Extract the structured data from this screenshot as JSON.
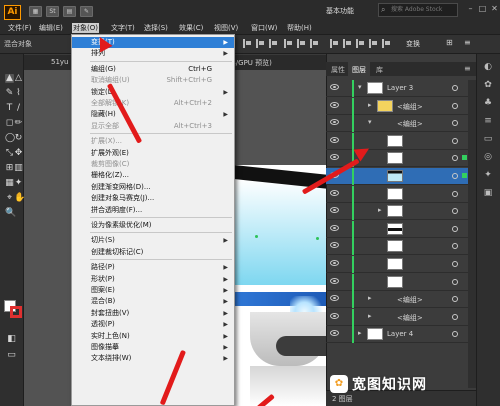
{
  "app": {
    "logo_text": "Ai",
    "workspace": "基本功能",
    "search_placeholder": "搜索 Adobe Stock",
    "control_label": "混合对象",
    "transform_label": "变换"
  },
  "menubar": [
    "文件(F)",
    "编辑(E)",
    "对象(O)",
    "文字(T)",
    "选择(S)",
    "效果(C)",
    "视图(V)",
    "窗口(W)",
    "帮助(H)"
  ],
  "toolbar_icons": {
    "st": "St"
  },
  "doc_tabs": {
    "left": "51yu",
    "right": "B/GPU 预览)"
  },
  "object_menu": [
    {
      "label": "变换(T)",
      "shortcut": "",
      "submenu": true,
      "disabled": false,
      "highlight": true
    },
    {
      "label": "排列",
      "shortcut": "",
      "submenu": true,
      "disabled": false
    },
    {
      "sep": true
    },
    {
      "label": "编组(G)",
      "shortcut": "Ctrl+G",
      "submenu": false,
      "disabled": false
    },
    {
      "label": "取消编组(U)",
      "shortcut": "Shift+Ctrl+G",
      "submenu": false,
      "disabled": true
    },
    {
      "label": "锁定(L)",
      "shortcut": "",
      "submenu": true,
      "disabled": false
    },
    {
      "label": "全部解锁(K)",
      "shortcut": "Alt+Ctrl+2",
      "submenu": false,
      "disabled": true
    },
    {
      "label": "隐藏(H)",
      "shortcut": "",
      "submenu": true,
      "disabled": false
    },
    {
      "label": "显示全部",
      "shortcut": "Alt+Ctrl+3",
      "submenu": false,
      "disabled": true
    },
    {
      "sep": true
    },
    {
      "label": "扩展(X)...",
      "shortcut": "",
      "submenu": false,
      "disabled": true
    },
    {
      "label": "扩展外观(E)",
      "shortcut": "",
      "submenu": false,
      "disabled": false
    },
    {
      "label": "裁剪图像(C)",
      "shortcut": "",
      "submenu": false,
      "disabled": true
    },
    {
      "label": "栅格化(Z)...",
      "shortcut": "",
      "submenu": false,
      "disabled": false
    },
    {
      "label": "创建渐变网格(D)...",
      "shortcut": "",
      "submenu": false,
      "disabled": false
    },
    {
      "label": "创建对象马赛克(J)...",
      "shortcut": "",
      "submenu": false,
      "disabled": false
    },
    {
      "label": "拼合透明度(F)...",
      "shortcut": "",
      "submenu": false,
      "disabled": false
    },
    {
      "sep": true
    },
    {
      "label": "设为像素级优化(M)",
      "shortcut": "",
      "submenu": false,
      "disabled": false
    },
    {
      "sep": true
    },
    {
      "label": "切片(S)",
      "shortcut": "",
      "submenu": true,
      "disabled": false
    },
    {
      "label": "创建裁切标记(C)",
      "shortcut": "",
      "submenu": false,
      "disabled": false
    },
    {
      "sep": true
    },
    {
      "label": "路径(P)",
      "shortcut": "",
      "submenu": true,
      "disabled": false
    },
    {
      "label": "形状(P)",
      "shortcut": "",
      "submenu": true,
      "disabled": false
    },
    {
      "label": "图案(E)",
      "shortcut": "",
      "submenu": true,
      "disabled": false
    },
    {
      "label": "混合(B)",
      "shortcut": "",
      "submenu": true,
      "disabled": false
    },
    {
      "label": "封套扭曲(V)",
      "shortcut": "",
      "submenu": true,
      "disabled": false
    },
    {
      "label": "透视(P)",
      "shortcut": "",
      "submenu": true,
      "disabled": false
    },
    {
      "label": "实时上色(N)",
      "shortcut": "",
      "submenu": true,
      "disabled": false
    },
    {
      "label": "图像描摹",
      "shortcut": "",
      "submenu": true,
      "disabled": false
    },
    {
      "label": "文本绕排(W)",
      "shortcut": "",
      "submenu": true,
      "disabled": false
    }
  ],
  "layers_panel": {
    "tabs": [
      "属性",
      "图层",
      "库"
    ],
    "active_tab": "图层",
    "layer_count": "2 图层",
    "rows": [
      {
        "indent": 0,
        "twirl": "▾",
        "name": "Layer 3",
        "thumb": "layer",
        "selected": false,
        "square": false
      },
      {
        "indent": 1,
        "twirl": "▸",
        "name": "<编组>",
        "thumb": "yellow",
        "selected": false,
        "square": false
      },
      {
        "indent": 1,
        "twirl": "▾",
        "name": "<编组>",
        "thumb": "blank",
        "selected": false,
        "square": false
      },
      {
        "indent": 2,
        "twirl": "",
        "name": "",
        "thumb": "white",
        "selected": false,
        "square": false
      },
      {
        "indent": 2,
        "twirl": "",
        "name": "",
        "thumb": "white",
        "selected": false,
        "square": true
      },
      {
        "indent": 2,
        "twirl": "",
        "name": "",
        "thumb": "screen",
        "selected": true,
        "square": true
      },
      {
        "indent": 2,
        "twirl": "",
        "name": "",
        "thumb": "white",
        "selected": false,
        "square": false
      },
      {
        "indent": 2,
        "twirl": "▸",
        "name": "",
        "thumb": "white",
        "selected": false,
        "square": false
      },
      {
        "indent": 2,
        "twirl": "",
        "name": "",
        "thumb": "dark",
        "selected": false,
        "square": false
      },
      {
        "indent": 2,
        "twirl": "",
        "name": "",
        "thumb": "white",
        "selected": false,
        "square": false
      },
      {
        "indent": 2,
        "twirl": "",
        "name": "",
        "thumb": "white",
        "selected": false,
        "square": false
      },
      {
        "indent": 2,
        "twirl": "",
        "name": "",
        "thumb": "white",
        "selected": false,
        "square": false
      },
      {
        "indent": 1,
        "twirl": "▸",
        "name": "<编组>",
        "thumb": "blank",
        "selected": false,
        "square": false
      },
      {
        "indent": 1,
        "twirl": "▸",
        "name": "<编组>",
        "thumb": "blank",
        "selected": false,
        "square": false
      },
      {
        "indent": 0,
        "twirl": "▸",
        "name": "Layer 4",
        "thumb": "layer",
        "selected": false,
        "square": false
      }
    ]
  },
  "watermark": "宽图知识网",
  "colors": {
    "accent": "#2e7fd6",
    "layer_bar": "#33d05f",
    "arrow": "#e21b1b",
    "logo": "#ff9a00"
  }
}
